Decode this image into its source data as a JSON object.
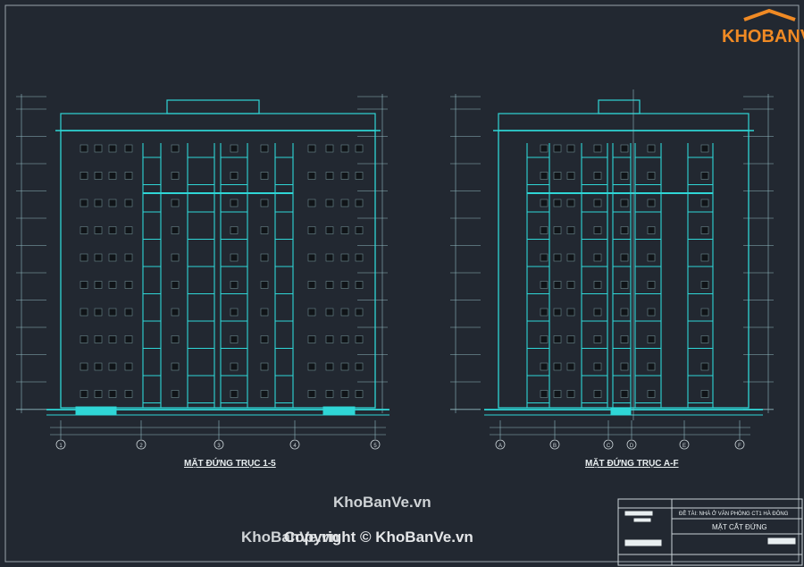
{
  "drawing": {
    "elevation_1": {
      "title": "MẶT ĐỨNG TRỤC 1-5",
      "axis_labels": [
        "1",
        "2",
        "3",
        "4",
        "5"
      ]
    },
    "elevation_2": {
      "title": "MẶT ĐỨNG TRỤC A-F",
      "axis_labels": [
        "A",
        "B",
        "C",
        "D",
        "E",
        "F"
      ]
    }
  },
  "title_block": {
    "project": "ĐỀ TÀI: NHÀ Ở VĂN PHÒNG CT1 HÀ ĐÔNG",
    "sheet_title": "MẶT CẮT ĐỨNG"
  },
  "watermark": {
    "logo_text": "KHOBANVE",
    "site": "KhoBanVe.vn",
    "copyright_overlap": "KhoBanVe.vn",
    "copyright": "Copyright © KhoBanVe.vn"
  },
  "colors": {
    "background": "#222831",
    "linework": "#2fd6d6",
    "text": "#e8eef0",
    "logo_orange": "#f08a24"
  }
}
